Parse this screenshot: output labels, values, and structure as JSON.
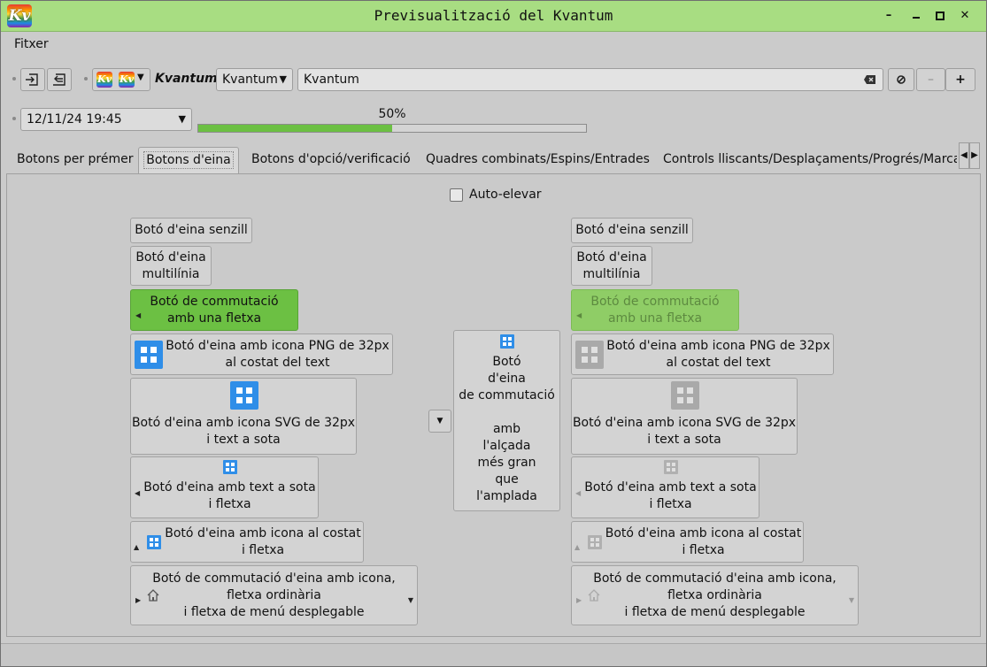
{
  "window": {
    "title": "Previsualització del Kvantum",
    "logo_text": "Kv",
    "controls": {
      "minimize": "–",
      "maximize": "□",
      "close": "✕",
      "help": "?"
    }
  },
  "menu": {
    "file": "Fitxer"
  },
  "toolbar": {
    "style_label": "Kvantum",
    "combo_value": "Kvantum",
    "search_value": "Kvantum",
    "clear_icon": "⌫",
    "zero_icon": "⃠",
    "minus": "–",
    "plus": "+"
  },
  "datetime": {
    "value": "12/11/24 19:45",
    "arrow": "▼"
  },
  "progress": {
    "label": "50%",
    "value": 0.5
  },
  "tabs": [
    "Botons per prémer",
    "Botons d'eina",
    "Botons d'opció/verificació",
    "Quadres combinats/Espins/Entrades",
    "Controls lliscants/Desplaçaments/Progrés/Marcaci"
  ],
  "autoraise": {
    "label": "Auto-elevar"
  },
  "buttons": {
    "simple": "Botó d'eina senzill",
    "multiline_1": "Botó d'eina",
    "multiline_2": "multilínia",
    "toggle_arrow_1": "Botó de commutació",
    "toggle_arrow_2": "amb una fletxa",
    "png_1": "Botó d'eina amb icona PNG de 32px",
    "png_2": "al costat del text",
    "svg_1": "Botó d'eina amb icona SVG de 32px",
    "svg_2": "i text a sota",
    "textbelow_1": "Botó d'eina amb text a sota",
    "textbelow_2": "i fletxa",
    "iconbeside_1": "Botó d'eina amb icona al costat",
    "iconbeside_2": "i fletxa",
    "menu_1": "Botó de commutació d'eina amb icona,",
    "menu_2": "fletxa ordinària",
    "menu_3": "i fletxa de menú desplegable"
  },
  "tall_button": {
    "lines": [
      "Botó",
      "d'eina",
      "de commutació",
      "",
      "amb",
      "l'alçada",
      "més gran",
      "que",
      "l'amplada"
    ]
  },
  "icons": [
    "input-icon",
    "output-icon",
    "kvantum-logo-icon",
    "add-square-icon",
    "home-icon",
    "arrow-left-icon",
    "arrow-up-icon",
    "arrow-right-icon",
    "arrow-down-icon"
  ],
  "colors": {
    "titlebar": "#a8dd82",
    "accent": "#6cc043",
    "icon_blue": "#2f8ee8"
  }
}
